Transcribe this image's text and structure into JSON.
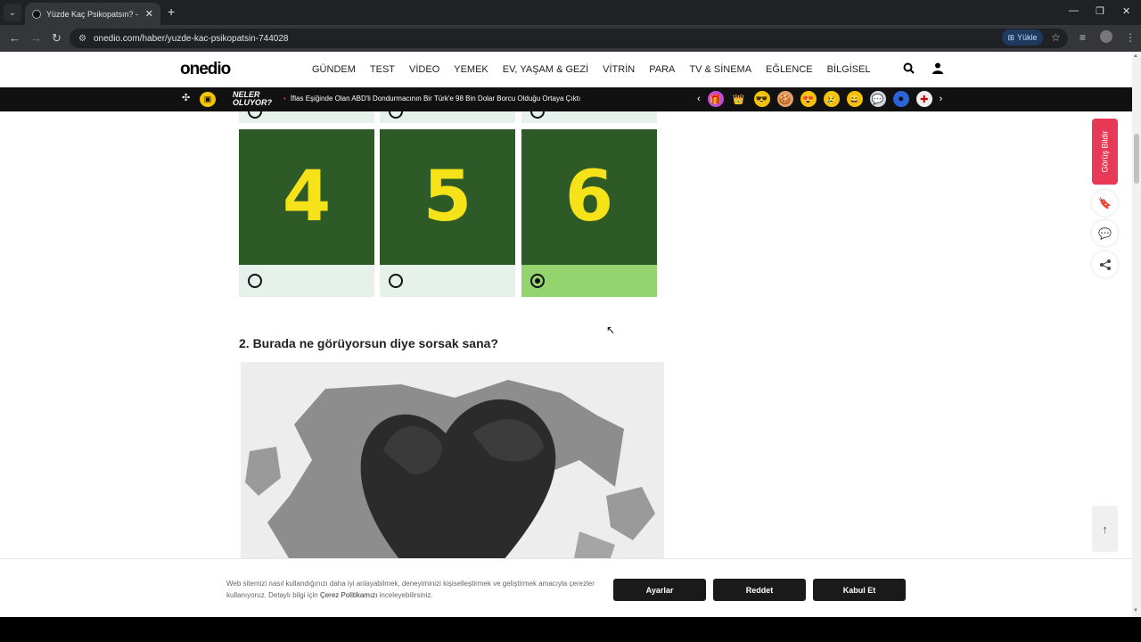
{
  "browser": {
    "tab_title": "Yüzde Kaç Psikopatsın? - Onedio",
    "url": "onedio.com/haber/yuzde-kac-psikopatsin-744028",
    "install_label": "Yükle"
  },
  "header": {
    "logo": "onedio",
    "menu": [
      "GÜNDEM",
      "TEST",
      "VİDEO",
      "YEMEK",
      "EV, YAŞAM & GEZİ",
      "VİTRİN",
      "PARA",
      "TV & SİNEMA",
      "EĞLENCE",
      "BİLGİSEL"
    ]
  },
  "newsbar": {
    "neler_line1": "NELER",
    "neler_line2": "OLUYOR?",
    "headline": "İflas Eşiğinde Olan ABD'li Dondurmacının Bir Türk'e 98 Bin Dolar Borcu Olduğu Ortaya Çıktı"
  },
  "quiz": {
    "options": [
      {
        "label": "4",
        "selected": false
      },
      {
        "label": "5",
        "selected": false
      },
      {
        "label": "6",
        "selected": true
      }
    ],
    "question2": "2. Burada ne görüyorsun diye sorsak sana?"
  },
  "sidebar": {
    "feedback_label": "Görüş Bildir"
  },
  "cookie": {
    "text_before": "Web sitemizi nasıl kullandığınızı daha iyi anlayabilmek, deneyiminizi kişiselleştirmek ve geliştirmek amacıyla çerezler kullanıyoruz. Detaylı bilgi için ",
    "link": "Çerez Politikamızı",
    "text_after": " inceleyebilirsiniz.",
    "settings_label": "Ayarlar",
    "reject_label": "Reddet",
    "accept_label": "Kabul Et"
  },
  "colors": {
    "option_bg": "#2e5a27",
    "option_digit": "#f6e218",
    "selected_footer": "#93d46e",
    "feedback_red": "#e83a56"
  }
}
